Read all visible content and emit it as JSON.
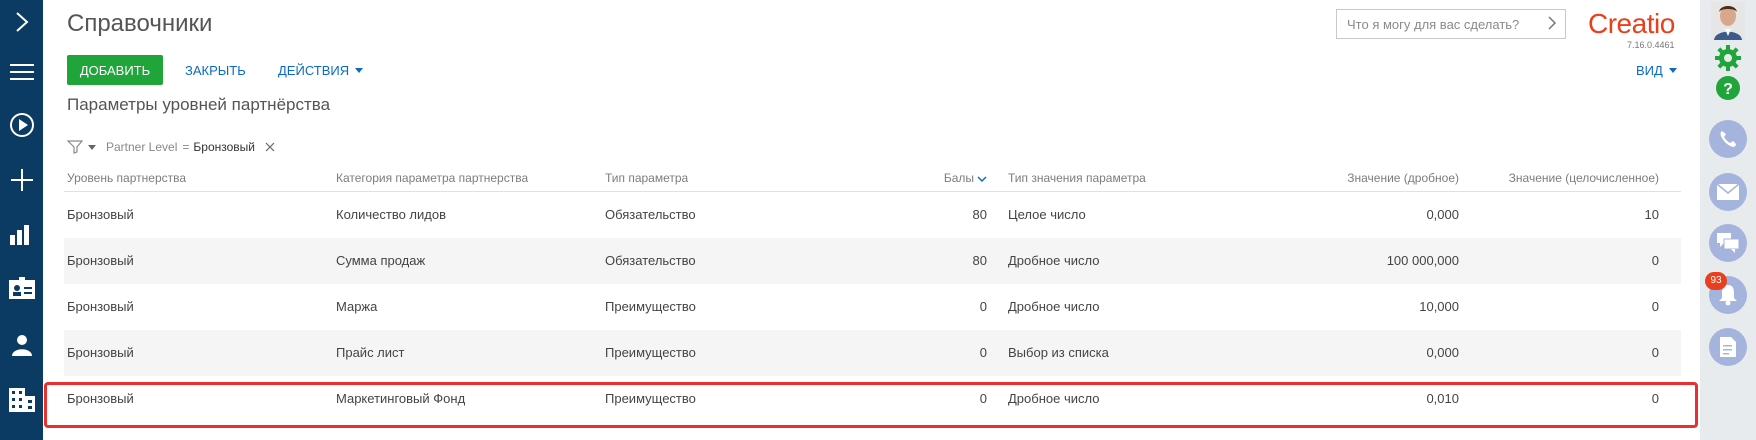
{
  "header": {
    "title": "Справочники",
    "search_placeholder": "Что я могу для вас сделать?",
    "logo": "Creatio",
    "version": "7.16.0.4461"
  },
  "toolbar": {
    "add_label": "ДОБАВИТЬ",
    "close_label": "ЗАКРЫТЬ",
    "actions_label": "ДЕЙСТВИЯ",
    "view_label": "ВИД"
  },
  "section": {
    "title": "Параметры уровней партнёрства"
  },
  "filter": {
    "column": "Partner Level",
    "operator": "=",
    "value": "Бронзовый"
  },
  "grid": {
    "columns": [
      "Уровень партнерства",
      "Категория параметра партнерства",
      "Тип параметра",
      "Балы",
      "Тип значения параметра",
      "Значение (дробное)",
      "Значение (целочисленное)"
    ],
    "sorted_column": "Балы",
    "rows": [
      [
        "Бронзовый",
        "Количество лидов",
        "Обязательство",
        "80",
        "Целое число",
        "0,000",
        "10"
      ],
      [
        "Бронзовый",
        "Сумма продаж",
        "Обязательство",
        "80",
        "Дробное число",
        "100 000,000",
        "0"
      ],
      [
        "Бронзовый",
        "Маржа",
        "Преимущество",
        "0",
        "Дробное число",
        "10,000",
        "0"
      ],
      [
        "Бронзовый",
        "Прайс лист",
        "Преимущество",
        "0",
        "Выбор из списка",
        "0,000",
        "0"
      ],
      [
        "Бронзовый",
        "Маркетинговый Фонд",
        "Преимущество",
        "0",
        "Дробное число",
        "0,010",
        "0"
      ]
    ],
    "highlighted_row": 4
  },
  "rightbar": {
    "notifications_count": "93"
  },
  "colors": {
    "leftbar": "#0b3a63",
    "add_button": "#1fa539",
    "link": "#0d6ac3",
    "brand": "#e8401c",
    "highlight": "#e8312f",
    "comm_icon": "#a5b4dd"
  }
}
